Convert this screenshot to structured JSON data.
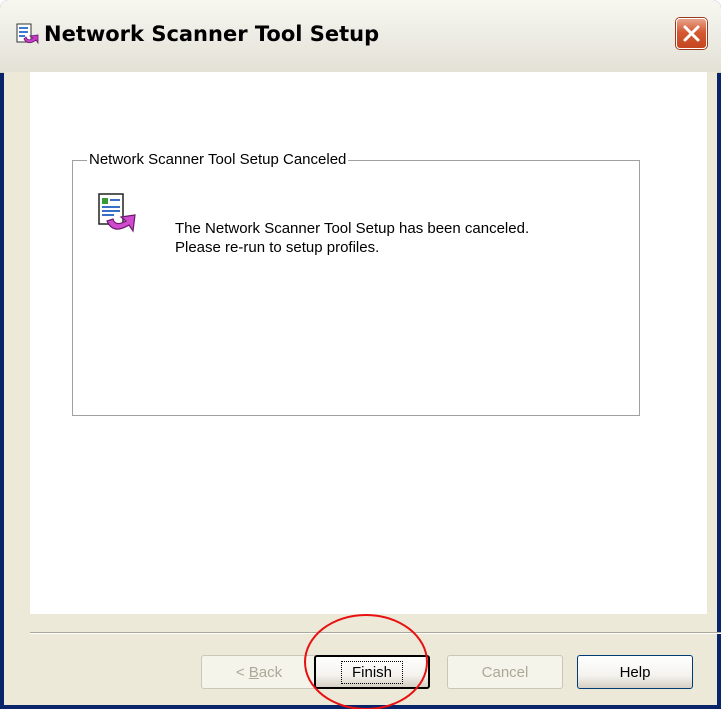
{
  "window": {
    "title": "Network Scanner Tool Setup"
  },
  "group": {
    "label": "Network Scanner Tool Setup Canceled"
  },
  "message": {
    "line1": "The Network Scanner Tool Setup has been canceled.",
    "line2": "Please re-run to setup profiles."
  },
  "buttons": {
    "back_prefix": "< ",
    "back_accel": "B",
    "back_rest": "ack",
    "finish": "Finish",
    "cancel": "Cancel",
    "help": "Help"
  },
  "state": {
    "back_enabled": false,
    "cancel_enabled": false,
    "default_button": "Finish"
  },
  "colors": {
    "titlebar": "#ecebe3",
    "client_bg": "#ece9d8",
    "panel_bg": "#ffffff",
    "close_button": "#d45a34",
    "highlight_circle": "#e81010",
    "disabled_text": "#aca899"
  },
  "icons": {
    "title": "setup-wizard-icon",
    "message": "document-arrow-icon",
    "close": "close-icon"
  }
}
